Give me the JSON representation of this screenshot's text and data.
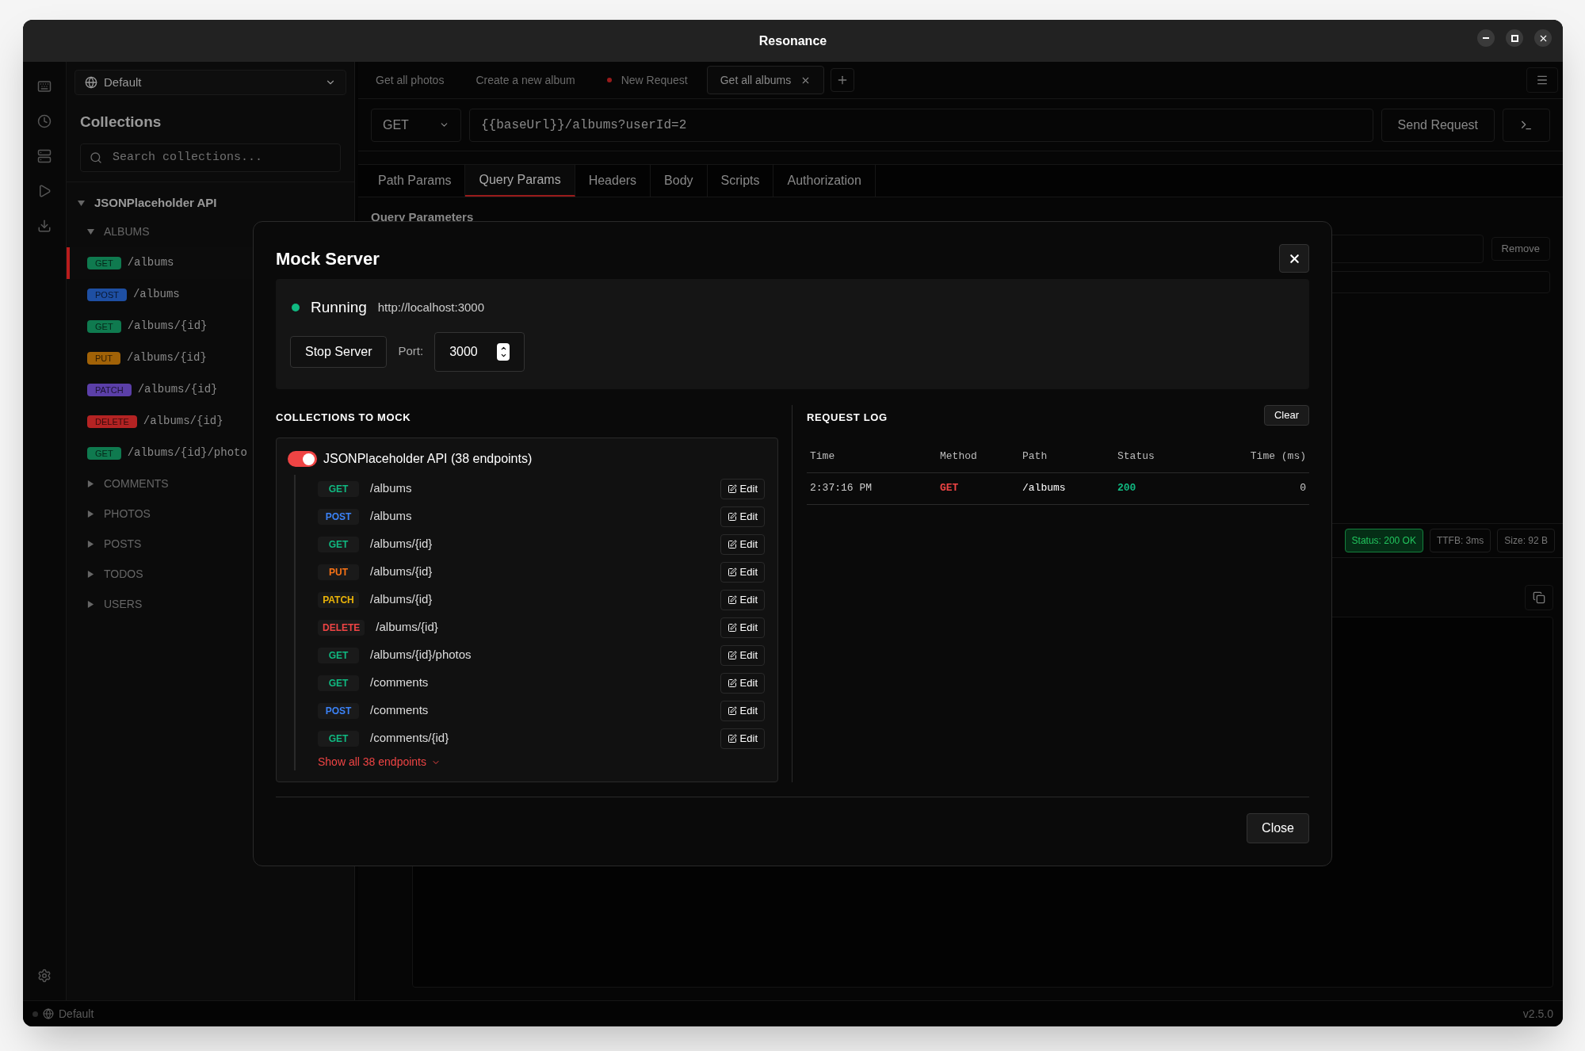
{
  "window": {
    "title": "Resonance"
  },
  "sidebar": {
    "environment": "Default",
    "heading": "Collections",
    "search": {
      "placeholder": "Search collections..."
    },
    "tree": [
      {
        "label": "JSONPlaceholder API",
        "expanded": true,
        "children": [
          {
            "label": "ALBUMS",
            "expanded": true,
            "children": [
              {
                "method": "GET",
                "color": "#0f7a4f",
                "path": "/albums",
                "selected": true
              },
              {
                "method": "POST",
                "color": "#1e4fa3",
                "path": "/albums",
                "selected": false
              },
              {
                "method": "GET",
                "color": "#0f7a4f",
                "path": "/albums/{id}",
                "selected": false
              },
              {
                "method": "PUT",
                "color": "#a16207",
                "path": "/albums/{id}",
                "selected": false
              },
              {
                "method": "PATCH",
                "color": "#5b3fa8",
                "path": "/albums/{id}",
                "selected": false
              },
              {
                "method": "DELETE",
                "color": "#b42323",
                "path": "/albums/{id}",
                "selected": false
              },
              {
                "method": "GET",
                "color": "#0f7a4f",
                "path": "/albums/{id}/photo",
                "selected": false
              }
            ]
          },
          {
            "label": "COMMENTS",
            "expanded": false
          },
          {
            "label": "PHOTOS",
            "expanded": false
          },
          {
            "label": "POSTS",
            "expanded": false
          },
          {
            "label": "TODOS",
            "expanded": false
          },
          {
            "label": "USERS",
            "expanded": false
          }
        ]
      }
    ]
  },
  "tabs": [
    {
      "label": "Get all photos",
      "selected": false,
      "unsaved": false
    },
    {
      "label": "Create a new album",
      "selected": false,
      "unsaved": false
    },
    {
      "label": "New Request",
      "selected": false,
      "unsaved": true
    },
    {
      "label": "Get all albums",
      "selected": true,
      "unsaved": false
    }
  ],
  "request": {
    "method": "GET",
    "url": "{{baseUrl}}/albums?userId=2",
    "send_label": "Send Request"
  },
  "param_tabs": [
    {
      "label": "Path Params",
      "selected": false
    },
    {
      "label": "Query Params",
      "selected": true
    },
    {
      "label": "Headers",
      "selected": false
    },
    {
      "label": "Body",
      "selected": false
    },
    {
      "label": "Scripts",
      "selected": false
    },
    {
      "label": "Authorization",
      "selected": false
    }
  ],
  "params": {
    "heading": "Query Parameters",
    "remove_label": "Remove"
  },
  "response": {
    "badges": [
      {
        "text": "Status: 200 OK",
        "kind": "status"
      },
      {
        "text": "TTFB: 3ms",
        "kind": "plain"
      },
      {
        "text": "Size: 92 B",
        "kind": "plain"
      }
    ]
  },
  "status_bar": {
    "environment": "Default",
    "version": "v2.5.0"
  },
  "modal": {
    "title": "Mock Server",
    "running": true,
    "state_label": "Running",
    "address": "http://localhost:3000",
    "stop_label": "Stop Server",
    "port_label": "Port:",
    "port": "3000",
    "collections_heading": "COLLECTIONS TO MOCK",
    "collection": {
      "on": true,
      "name": "JSONPlaceholder API (38 endpoints)",
      "show_all": "Show all 38 endpoints",
      "endpoints": [
        {
          "method": "GET",
          "color": "#10b981",
          "path": "/albums",
          "edit_label": "Edit"
        },
        {
          "method": "POST",
          "color": "#3b82f6",
          "path": "/albums",
          "edit_label": "Edit"
        },
        {
          "method": "GET",
          "color": "#10b981",
          "path": "/albums/{id}",
          "edit_label": "Edit"
        },
        {
          "method": "PUT",
          "color": "#f97316",
          "path": "/albums/{id}",
          "edit_label": "Edit"
        },
        {
          "method": "PATCH",
          "color": "#eab308",
          "path": "/albums/{id}",
          "edit_label": "Edit"
        },
        {
          "method": "DELETE",
          "color": "#ef4444",
          "path": "/albums/{id}",
          "edit_label": "Edit"
        },
        {
          "method": "GET",
          "color": "#10b981",
          "path": "/albums/{id}/photos",
          "edit_label": "Edit"
        },
        {
          "method": "GET",
          "color": "#10b981",
          "path": "/comments",
          "edit_label": "Edit"
        },
        {
          "method": "POST",
          "color": "#3b82f6",
          "path": "/comments",
          "edit_label": "Edit"
        },
        {
          "method": "GET",
          "color": "#10b981",
          "path": "/comments/{id}",
          "edit_label": "Edit"
        }
      ]
    },
    "log_heading": "REQUEST LOG",
    "clear_label": "Clear",
    "log_columns": [
      "Time",
      "Method",
      "Path",
      "Status",
      "Time (ms)"
    ],
    "log_rows": [
      [
        "2:37:16 PM",
        "GET",
        "/albums",
        "200",
        "0"
      ]
    ],
    "close_label": "Close"
  }
}
